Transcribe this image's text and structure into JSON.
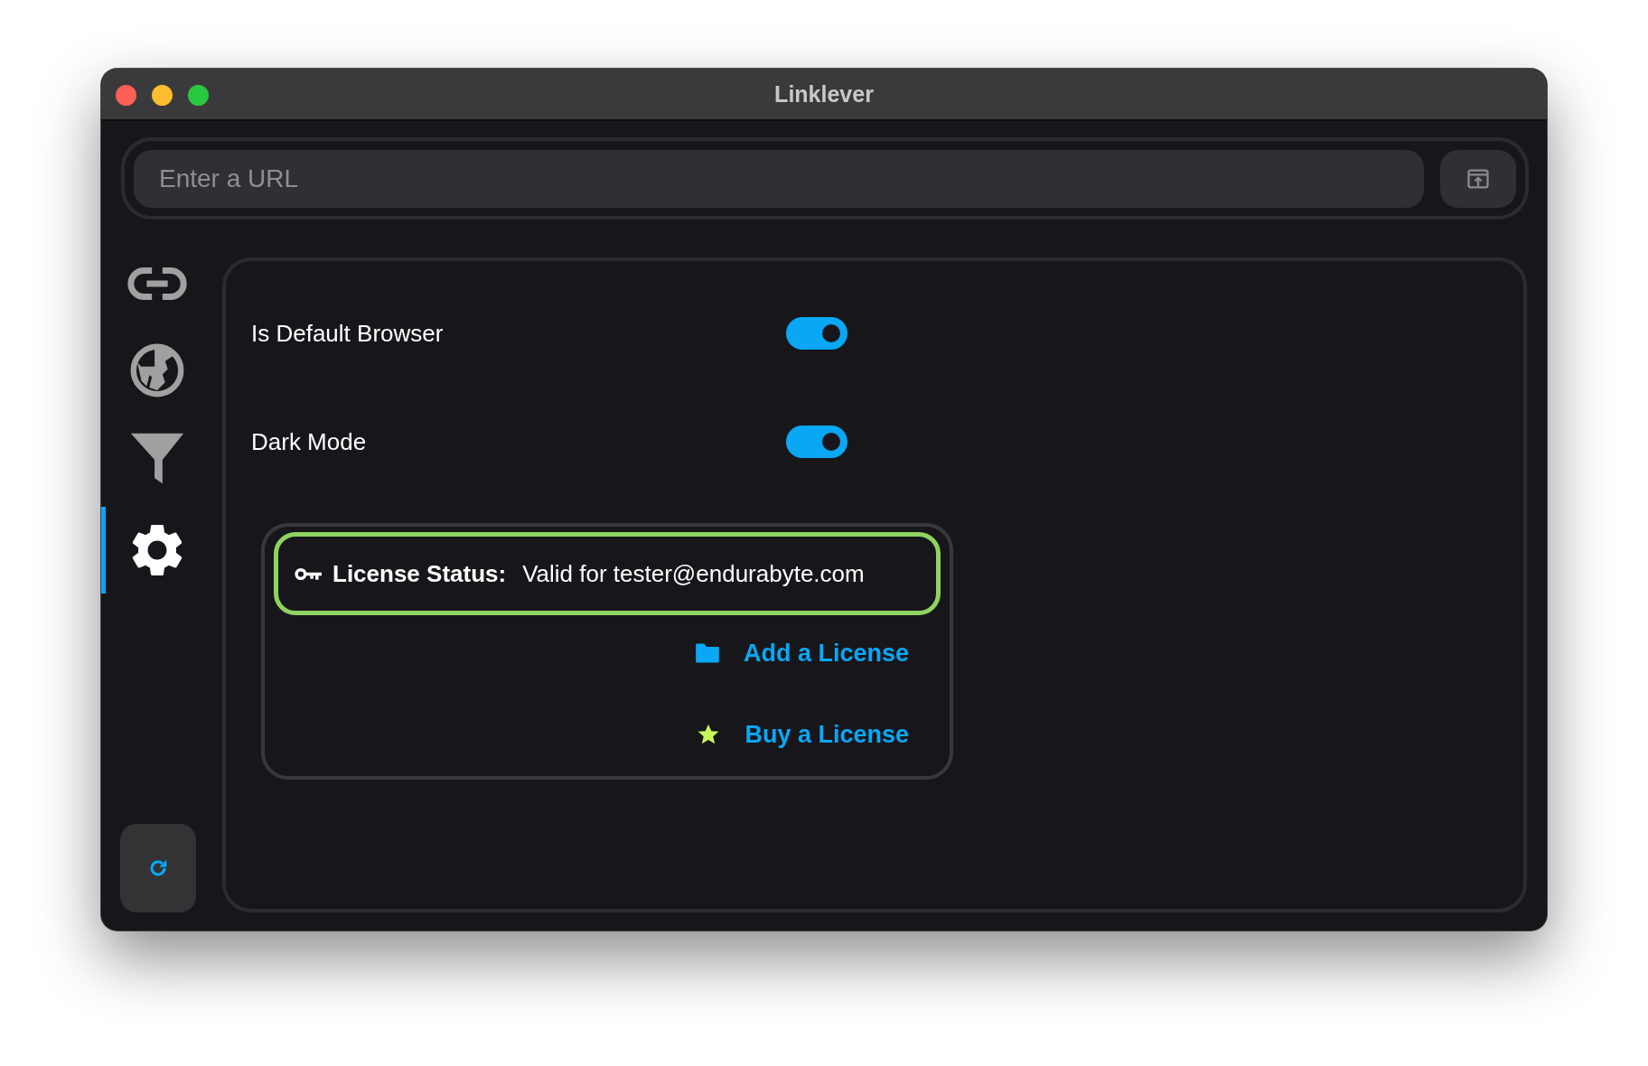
{
  "window": {
    "title": "Linklever"
  },
  "url_bar": {
    "placeholder": "Enter a URL"
  },
  "sidebar": {
    "items": [
      {
        "kind": "link",
        "selected": false
      },
      {
        "kind": "globe",
        "selected": false
      },
      {
        "kind": "filter",
        "selected": false
      },
      {
        "kind": "settings",
        "selected": true
      }
    ]
  },
  "settings": [
    {
      "label": "Is Default Browser",
      "on": true
    },
    {
      "label": "Dark Mode",
      "on": true
    }
  ],
  "license": {
    "label": "License Status:",
    "value": "Valid for tester@endurabyte.com",
    "actions": [
      {
        "kind": "add",
        "label": "Add a License"
      },
      {
        "kind": "buy",
        "label": "Buy a License"
      }
    ]
  }
}
